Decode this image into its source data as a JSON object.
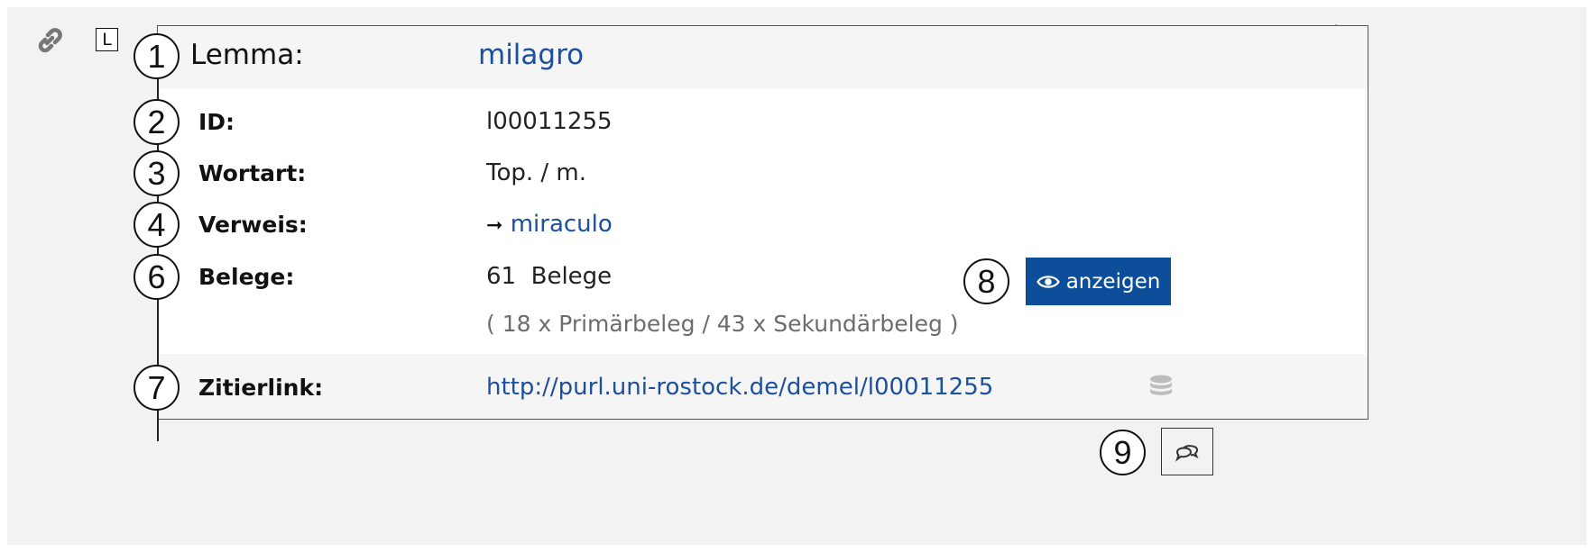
{
  "entry": {
    "type_badge": "L",
    "lemma_label": "Lemma:",
    "lemma_value": "milagro",
    "id_label": "ID:",
    "id_value": "l00011255",
    "wortart_label": "Wortart:",
    "wortart_value": "Top. / m.",
    "verweis_label": "Verweis:",
    "verweis_arrow": "➞",
    "verweis_value": "miraculo",
    "belege_label": "Belege:",
    "belege_count": "61",
    "belege_word": "Belege",
    "belege_detail": "( 18 x Primärbeleg / 43 x Sekundärbeleg  )",
    "show_button_label": "anzeigen",
    "zitierlink_label": "Zitierlink:",
    "zitierlink_value": "http://purl.uni-rostock.de/demel/l00011255"
  },
  "markers": [
    "1",
    "2",
    "3",
    "4",
    "6",
    "7",
    "8",
    "9"
  ],
  "icons": {
    "link": "link-icon",
    "visibility": "eye-off-icon",
    "show": "eye-icon",
    "database": "database-icon",
    "comment": "comments-icon"
  },
  "colors": {
    "link_blue": "#1c4f9c",
    "button_blue": "#0d4e9b",
    "hidden_red": "#d9363e",
    "muted_gray": "#6c6c6c"
  }
}
